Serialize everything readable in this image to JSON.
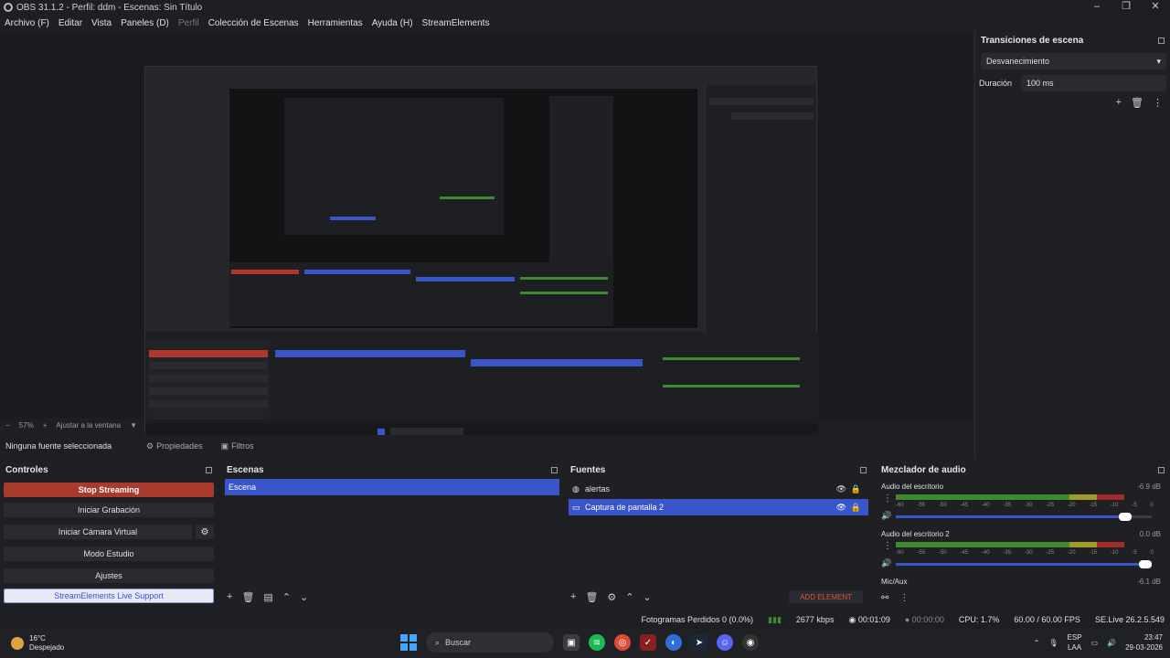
{
  "window": {
    "title": "OBS 31.1.2 - Perfil: ddm - Escenas: Sin Título",
    "controls": [
      "–",
      "❐",
      "✕"
    ]
  },
  "menu": {
    "items": [
      "Archivo (F)",
      "Editar",
      "Vista",
      "Paneles (D)",
      "Perfil",
      "Colección de Escenas",
      "Herramientas",
      "Ayuda (H)",
      "StreamElements"
    ]
  },
  "zoom": {
    "level": "57%",
    "fit_label": "Ajustar a la ventana"
  },
  "transitions": {
    "title": "Transiciones de escena",
    "selected": "Desvanecimiento",
    "duration_label": "Duración",
    "duration_value": "100 ms"
  },
  "properties_bar": {
    "no_source": "Ninguna fuente seleccionada",
    "properties_label": "Propiedades",
    "filters_label": "Filtros"
  },
  "controls": {
    "title": "Controles",
    "stop_streaming": "Stop Streaming",
    "start_recording": "Iniciar Grabación",
    "start_virtual_cam": "Iniciar Cámara Virtual",
    "studio_mode": "Modo Estudio",
    "settings": "Ajustes",
    "live_support": "StreamElements Live Support"
  },
  "scenes": {
    "title": "Escenas",
    "items": [
      "Escena"
    ]
  },
  "sources": {
    "title": "Fuentes",
    "items": [
      {
        "name": "alertas",
        "selected": false
      },
      {
        "name": "Captura de pantalla 2",
        "selected": true
      }
    ],
    "add_element": "ADD ELEMENT"
  },
  "mixer": {
    "title": "Mezclador de audio",
    "channels": [
      {
        "name": "Audio del escritorio",
        "db": "-6.9 dB",
        "volume": 0.87
      },
      {
        "name": "Audio del escritorio 2",
        "db": "0.0 dB",
        "volume": 1.0
      },
      {
        "name": "Mic/Aux",
        "db": "-6.1 dB"
      }
    ],
    "scale": [
      "-60",
      "-55",
      "-50",
      "-45",
      "-40",
      "-35",
      "-30",
      "-25",
      "-20",
      "-15",
      "-10",
      "-5",
      "0"
    ]
  },
  "status": {
    "dropped_frames": "Fotogramas Perdidos 0 (0.0%)",
    "bitrate": "2677 kbps",
    "stream_time": "00:01:09",
    "rec_time": "00:00:00",
    "cpu": "CPU: 1.7%",
    "fps": "60.00 / 60.00 FPS",
    "version": "SE.Live 26.2.5.549"
  },
  "taskbar": {
    "temperature": "16°C",
    "weather": "Despejado",
    "search_placeholder": "Buscar",
    "lang_top": "ESP",
    "lang_bottom": "LAA",
    "time": "23:47",
    "date": "29-03-2026"
  }
}
